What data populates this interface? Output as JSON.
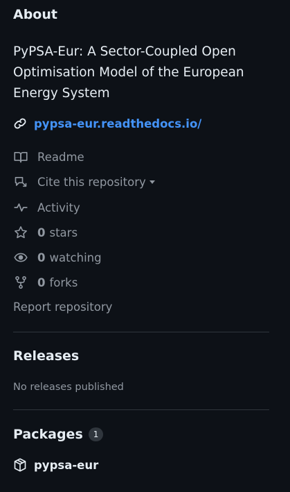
{
  "about": {
    "title": "About",
    "description": "PyPSA-Eur: A Sector-Coupled Open Optimisation Model of the European Energy System",
    "website": "pypsa-eur.readthedocs.io/"
  },
  "meta": {
    "readme": "Readme",
    "cite": "Cite this repository",
    "activity": "Activity",
    "stars_count": "0",
    "stars_label": "stars",
    "watching_count": "0",
    "watching_label": "watching",
    "forks_count": "0",
    "forks_label": "forks",
    "report": "Report repository"
  },
  "releases": {
    "title": "Releases",
    "empty_text": "No releases published"
  },
  "packages": {
    "title": "Packages",
    "count": "1",
    "items": [
      {
        "name": "pypsa-eur"
      }
    ]
  },
  "colors": {
    "background": "#0d1117",
    "text": "#e6edf3",
    "muted": "#9198a1",
    "link": "#4493f8",
    "border": "#30363d"
  }
}
